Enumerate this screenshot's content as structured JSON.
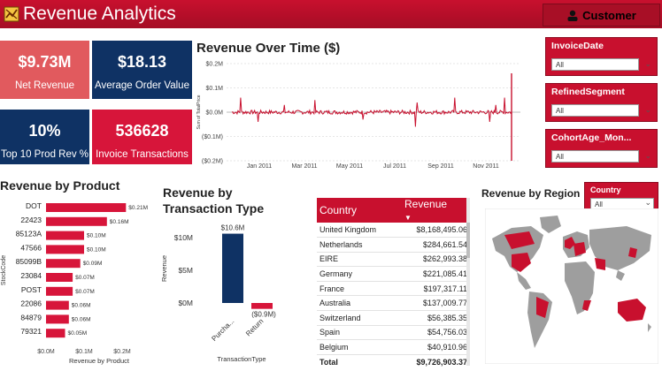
{
  "header": {
    "title": "Revenue Analytics",
    "customer_button": "Customer"
  },
  "colors": {
    "accent": "#c8102e",
    "navy": "#0f3264",
    "kpi_light_red": "#e15a5e"
  },
  "kpis": [
    {
      "value": "$9.73M",
      "label": "Net Revenue"
    },
    {
      "value": "$18.13",
      "label": "Average Order Value"
    },
    {
      "value": "10%",
      "label": "Top 10 Prod Rev %"
    },
    {
      "value": "536628",
      "label": "Invoice Transactions"
    }
  ],
  "slicers": [
    {
      "title": "InvoiceDate",
      "value": "All"
    },
    {
      "title": "RefinedSegment",
      "value": "All"
    },
    {
      "title": "CohortAge_Mon...",
      "value": "All"
    }
  ],
  "time_chart": {
    "title": "Revenue Over Time ($)",
    "ylabel": "Sum of TotalPrice",
    "yticks": [
      "$0.2M",
      "$0.1M",
      "$0.0M",
      "($0.1M)",
      "($0.2M)"
    ],
    "xticks": [
      "Jan 2011",
      "Mar 2011",
      "May 2011",
      "Jul 2011",
      "Sep 2011",
      "Nov 2011"
    ]
  },
  "product_chart": {
    "title": "Revenue by Product",
    "ylabel": "StockCode",
    "xlabel": "Revenue by Product",
    "xticks": [
      "$0.0M",
      "$0.1M",
      "$0.2M"
    ],
    "categories": [
      "DOT",
      "22423",
      "85123A",
      "47566",
      "85099B",
      "23084",
      "POST",
      "22086",
      "84879",
      "79321"
    ],
    "values": [
      0.21,
      0.16,
      0.1,
      0.1,
      0.09,
      0.07,
      0.07,
      0.06,
      0.06,
      0.05
    ],
    "labels": [
      "$0.21M",
      "$0.16M",
      "$0.10M",
      "$0.10M",
      "$0.09M",
      "$0.07M",
      "$0.07M",
      "$0.06M",
      "$0.06M",
      "$0.05M"
    ]
  },
  "transaction_chart": {
    "title": "Revenue by Transaction Type",
    "ylabel": "Revenue",
    "xlabel": "TransactionType",
    "yticks": [
      "$10M",
      "$5M",
      "$0M"
    ],
    "categories": [
      "Purcha...",
      "Return"
    ],
    "values": [
      10.6,
      -0.9
    ],
    "labels": [
      "$10.6M",
      "($0.9M)"
    ]
  },
  "country_table": {
    "headers": [
      "Country",
      "Revenue"
    ],
    "rows": [
      [
        "United Kingdom",
        "$8,168,495.06"
      ],
      [
        "Netherlands",
        "$284,661.54"
      ],
      [
        "EIRE",
        "$262,993.38"
      ],
      [
        "Germany",
        "$221,085.41"
      ],
      [
        "France",
        "$197,317.11"
      ],
      [
        "Australia",
        "$137,009.77"
      ],
      [
        "Switzerland",
        "$56,385.35"
      ],
      [
        "Spain",
        "$54,756.03"
      ],
      [
        "Belgium",
        "$40,910.96"
      ]
    ],
    "total": [
      "Total",
      "$9,726,903.37"
    ]
  },
  "region": {
    "title": "Revenue by Region",
    "slicer_title": "Country",
    "slicer_value": "All"
  },
  "chart_data": [
    {
      "type": "line",
      "title": "Revenue Over Time ($)",
      "ylabel": "Sum of TotalPrice",
      "ylim": [
        -0.2,
        0.2
      ],
      "x_range": [
        "2010-12",
        "2011-12"
      ],
      "series": [
        {
          "values_note_free": true
        }
      ]
    },
    {
      "type": "bar",
      "title": "Revenue by Product",
      "categories": [
        "DOT",
        "22423",
        "85123A",
        "47566",
        "85099B",
        "23084",
        "POST",
        "22086",
        "84879",
        "79321"
      ],
      "values": [
        0.21,
        0.16,
        0.1,
        0.1,
        0.09,
        0.07,
        0.07,
        0.06,
        0.06,
        0.05
      ],
      "xlabel": "Revenue by Product",
      "ylabel": "StockCode",
      "xlim": [
        0,
        0.2
      ]
    },
    {
      "type": "bar",
      "title": "Revenue by Transaction Type",
      "categories": [
        "Purcha...",
        "Return"
      ],
      "values": [
        10.6,
        -0.9
      ],
      "xlabel": "TransactionType",
      "ylabel": "Revenue",
      "ylim": [
        0,
        10
      ]
    }
  ]
}
